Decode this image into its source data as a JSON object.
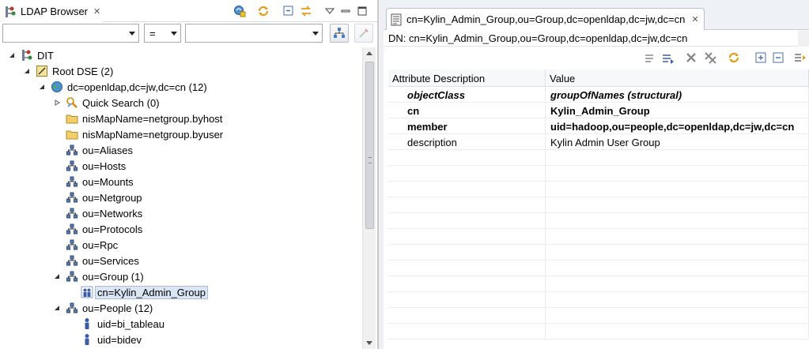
{
  "browser": {
    "title": "LDAP Browser",
    "filter": {
      "attribute_value": "",
      "operator_value": "=",
      "value_value": ""
    }
  },
  "tree": [
    {
      "label": "DIT",
      "icon": "dit-icon",
      "twisty": "expanded"
    },
    {
      "label": "Root DSE (2)",
      "icon": "root-dse-icon",
      "twisty": "expanded"
    },
    {
      "label": "dc=openldap,dc=jw,dc=cn (12)",
      "icon": "globe-icon",
      "twisty": "expanded"
    },
    {
      "label": "Quick Search (0)",
      "icon": "quick-search-icon",
      "twisty": "collapsed"
    },
    {
      "label": "nisMapName=netgroup.byhost",
      "icon": "folder-icon",
      "twisty": "none"
    },
    {
      "label": "nisMapName=netgroup.byuser",
      "icon": "folder-icon",
      "twisty": "none"
    },
    {
      "label": "ou=Aliases",
      "icon": "org-unit-icon",
      "twisty": "none"
    },
    {
      "label": "ou=Hosts",
      "icon": "org-unit-icon",
      "twisty": "none"
    },
    {
      "label": "ou=Mounts",
      "icon": "org-unit-icon",
      "twisty": "none"
    },
    {
      "label": "ou=Netgroup",
      "icon": "org-unit-icon",
      "twisty": "none"
    },
    {
      "label": "ou=Networks",
      "icon": "org-unit-icon",
      "twisty": "none"
    },
    {
      "label": "ou=Protocols",
      "icon": "org-unit-icon",
      "twisty": "none"
    },
    {
      "label": "ou=Rpc",
      "icon": "org-unit-icon",
      "twisty": "none"
    },
    {
      "label": "ou=Services",
      "icon": "org-unit-icon",
      "twisty": "none"
    },
    {
      "label": "ou=Group (1)",
      "icon": "org-unit-icon",
      "twisty": "expanded"
    },
    {
      "label": "cn=Kylin_Admin_Group",
      "icon": "group-icon",
      "twisty": "none",
      "selected": true
    },
    {
      "label": "ou=People (12)",
      "icon": "org-unit-icon",
      "twisty": "expanded"
    },
    {
      "label": "uid=bi_tableau",
      "icon": "person-icon",
      "twisty": "none"
    },
    {
      "label": "uid=bidev",
      "icon": "person-icon",
      "twisty": "none"
    }
  ],
  "editor": {
    "tab_title": "cn=Kylin_Admin_Group,ou=Group,dc=openldap,dc=jw,dc=cn",
    "dn": "DN: cn=Kylin_Admin_Group,ou=Group,dc=openldap,dc=jw,dc=cn",
    "columns": [
      "Attribute Description",
      "Value"
    ],
    "rows": [
      {
        "attr": "objectClass",
        "value": "groupOfNames (structural)",
        "style": "bolditalic"
      },
      {
        "attr": "cn",
        "value": "Kylin_Admin_Group",
        "style": "bold"
      },
      {
        "attr": "member",
        "value": "uid=hadoop,ou=people,dc=openldap,dc=jw,dc=cn",
        "style": "bold"
      },
      {
        "attr": "description",
        "value": "Kylin Admin User Group",
        "style": "normal"
      }
    ]
  },
  "colors": {
    "selection": "#dbe6f5",
    "refresh_orange": "#e89a1a",
    "folder_yellow": "#f3cf6a",
    "entry_blue": "#3a5da8",
    "delete_gray": "#8a8a8a"
  }
}
